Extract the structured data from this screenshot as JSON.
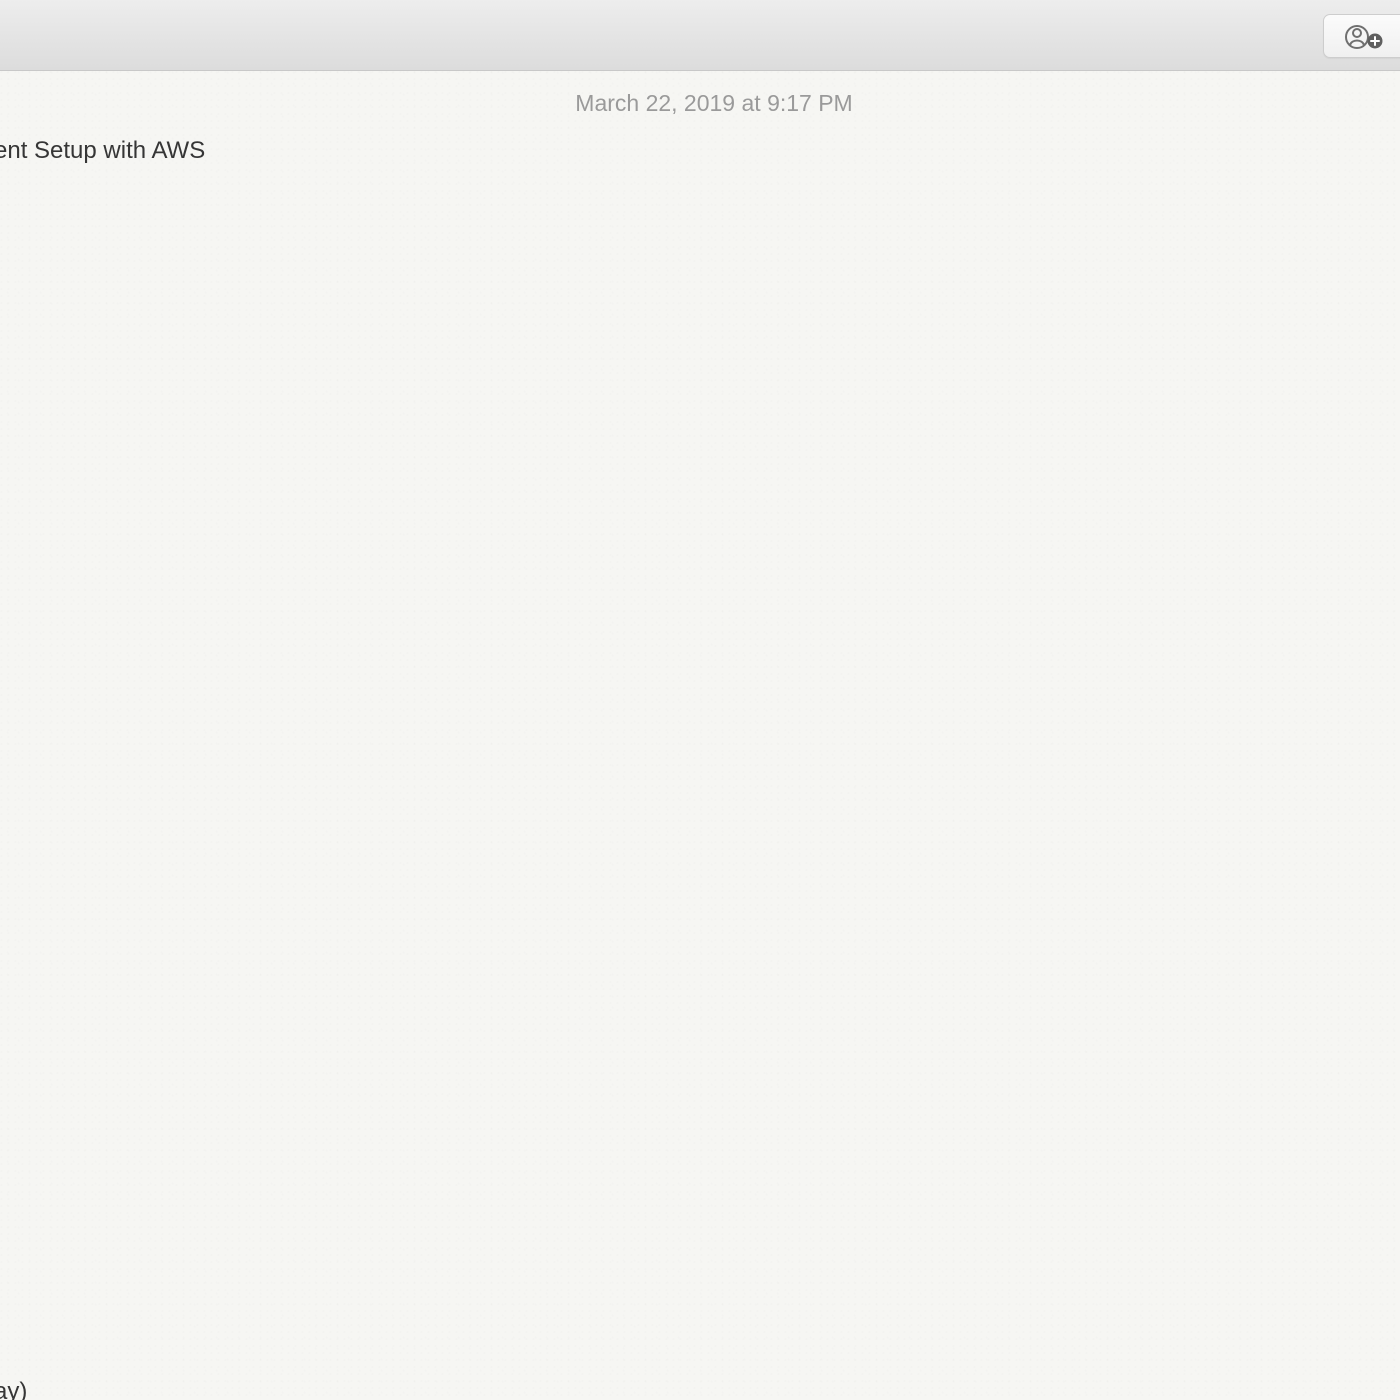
{
  "toolbar": {
    "share_button": {
      "icon": "add-person-icon",
      "color": "#6f6f6f"
    }
  },
  "note": {
    "date": "March 22, 2019 at 9:17 PM",
    "lines": [
      "ent Setup with AWS",
      "ay)"
    ]
  },
  "colors": {
    "toolbar": "#e4e4e4",
    "paper": "#f6f6f3",
    "text": "#363636",
    "date_text": "#9a9a9a"
  }
}
